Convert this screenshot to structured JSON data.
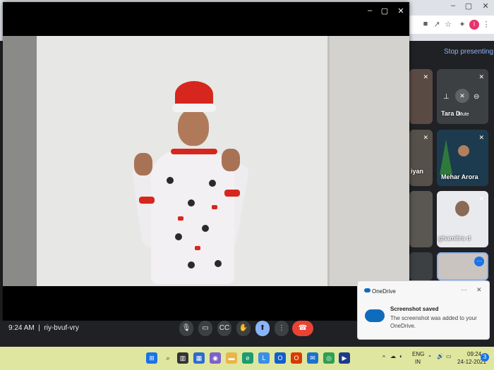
{
  "browser": {
    "window_controls": [
      "–",
      "▢",
      "✕"
    ],
    "toolbar_icons": [
      "video-icon",
      "share-icon",
      "star-icon",
      "extensions-icon"
    ],
    "profile_initial": "I",
    "menu_glyph": "⋮"
  },
  "meet": {
    "stop_presenting_label": "Stop presenting",
    "participants": [
      {
        "name": "",
        "muted": true
      },
      {
        "name": "Tara D",
        "muted": true,
        "hover_label": "Mute"
      },
      {
        "name": "iyan",
        "muted": false
      },
      {
        "name": "Mehar Arora",
        "muted": true
      },
      {
        "name": "",
        "muted": false
      },
      {
        "name": "ghamitra d",
        "muted": true
      }
    ],
    "meeting_time": "9:24 AM",
    "meeting_code": "riy-bvuf-vry",
    "controls": [
      "mic-icon",
      "camera-icon",
      "captions-icon",
      "raise-hand-icon",
      "present-icon",
      "more-icon",
      "end-call-icon"
    ]
  },
  "pip_window": {
    "controls": [
      "–",
      "▢",
      "✕"
    ]
  },
  "notification": {
    "app_name": "OneDrive",
    "more_glyph": "···",
    "close_glyph": "✕",
    "title": "Screenshot saved",
    "message": "The screenshot was added to your OneDrive."
  },
  "taskbar": {
    "language": "ENG",
    "region": "IN",
    "time": "09:24",
    "date": "24-12-2021",
    "notification_count": "3",
    "chevron": "^"
  },
  "colors": {
    "meet_bg": "#202124",
    "accent_blue": "#8ab4f8",
    "end_call_red": "#ea4335",
    "onedrive_blue": "#0f6cbd",
    "taskbar_bg": "#dfe6a0"
  }
}
